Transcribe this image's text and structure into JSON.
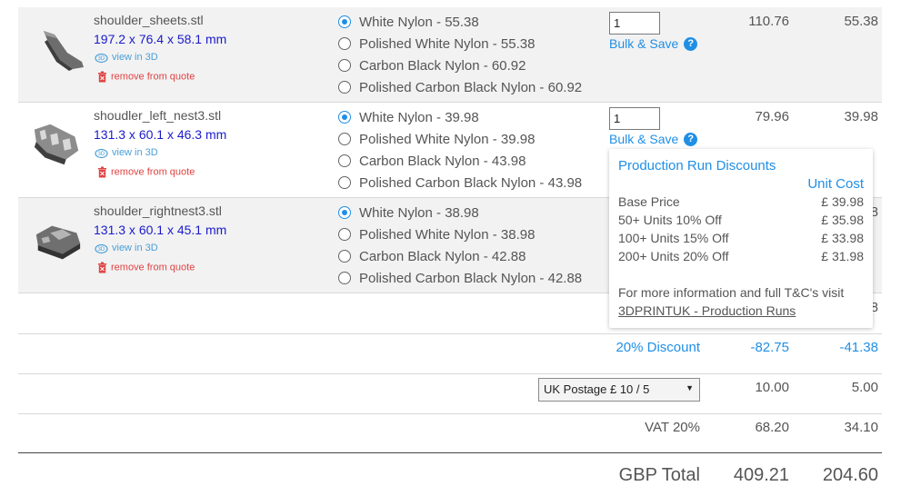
{
  "items": [
    {
      "filename": "shoulder_sheets.stl",
      "dimensions": "197.2 x 76.4 x 58.1 mm",
      "view_3d": "view in 3D",
      "remove": "remove from quote",
      "options": [
        "White Nylon - 55.38",
        "Polished White Nylon - 55.38",
        "Carbon Black Nylon - 60.92",
        "Polished Carbon Black Nylon - 60.92"
      ],
      "selected_index": 0,
      "quantity": "1",
      "bulk_label": "Bulk & Save",
      "price_a": "110.76",
      "price_b": "55.38"
    },
    {
      "filename": "shoudler_left_nest3.stl",
      "dimensions": "131.3 x 60.1 x 46.3 mm",
      "view_3d": "view in 3D",
      "remove": "remove from quote",
      "options": [
        "White Nylon - 39.98",
        "Polished White Nylon - 39.98",
        "Carbon Black Nylon - 43.98",
        "Polished Carbon Black Nylon - 43.98"
      ],
      "selected_index": 0,
      "quantity": "1",
      "bulk_label": "Bulk & Save",
      "price_a": "79.96",
      "price_b": "39.98"
    },
    {
      "filename": "shoulder_rightnest3.stl",
      "dimensions": "131.3 x 60.1 x 45.1 mm",
      "view_3d": "view in 3D",
      "remove": "remove from quote",
      "options": [
        "White Nylon - 38.98",
        "Polished White Nylon - 38.98",
        "Carbon Black Nylon - 42.88",
        "Polished Carbon Black Nylon - 42.88"
      ],
      "selected_index": 0,
      "price_b_partial": "8"
    }
  ],
  "popup": {
    "title": "Production Run Discounts",
    "unit_cost_header": "Unit Cost",
    "rows": [
      {
        "label": "Base Price",
        "value": "£ 39.98"
      },
      {
        "label": "50+ Units 10% Off",
        "value": "£ 35.98"
      },
      {
        "label": "100+ Units 15% Off",
        "value": "£ 33.98"
      },
      {
        "label": "200+ Units 20% Off",
        "value": "£ 31.98"
      }
    ],
    "info": "For more information and full T&C's visit",
    "link": "3DPRINTUK - Production Runs"
  },
  "subtotal_partial": "8",
  "discount": {
    "label": "20% Discount",
    "a": "-82.75",
    "b": "-41.38"
  },
  "postage": {
    "selected": "UK Postage £ 10 / 5",
    "a": "10.00",
    "b": "5.00"
  },
  "vat": {
    "label": "VAT 20%",
    "a": "68.20",
    "b": "34.10"
  },
  "total": {
    "label": "GBP Total",
    "a": "409.21",
    "b": "204.60"
  },
  "colors": {
    "accent": "#1f8fe6",
    "dims": "#1a1acc",
    "remove": "#e04343",
    "row_bg": "#f2f2f2"
  },
  "icons": {
    "bulk_help": "question-icon",
    "view3d": "rotate-3d-icon",
    "remove": "trash-icon",
    "select": "chevron-down-icon"
  }
}
